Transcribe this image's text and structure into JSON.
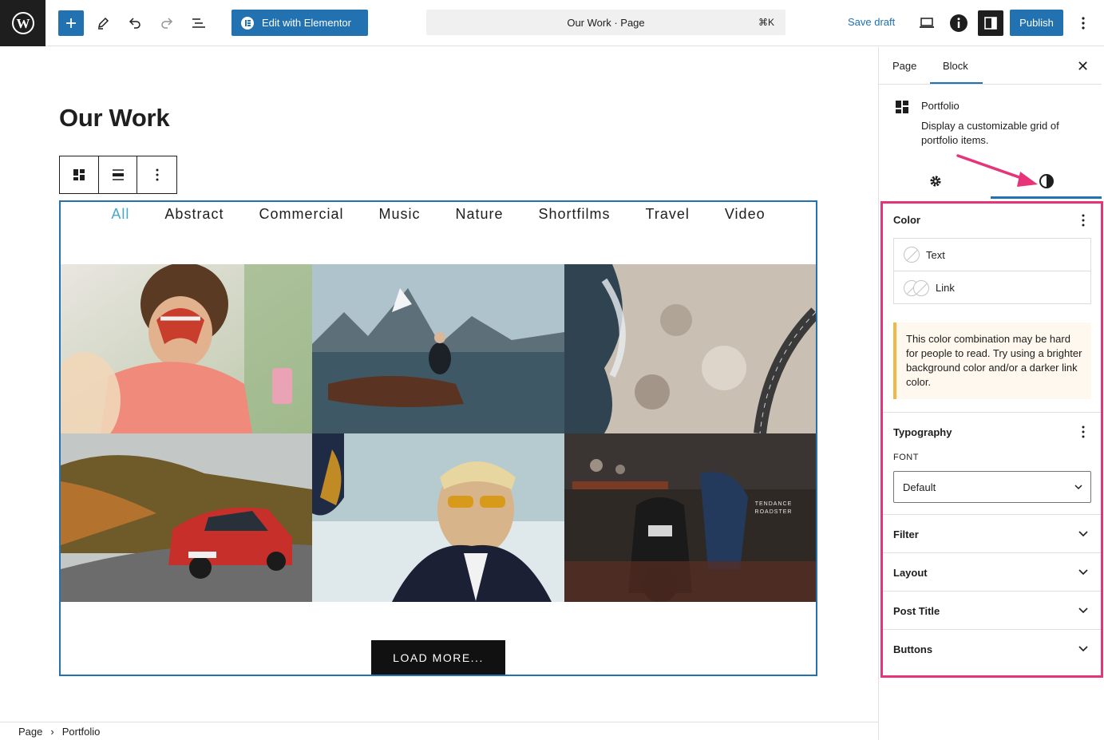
{
  "topbar": {
    "edit_elementor_label": "Edit with Elementor",
    "command_title": "Our Work · Page",
    "command_shortcut": "⌘K",
    "save_draft_label": "Save draft",
    "publish_label": "Publish"
  },
  "canvas": {
    "page_title": "Our Work",
    "filters": [
      "All",
      "Abstract",
      "Commercial",
      "Music",
      "Nature",
      "Shortfilms",
      "Travel",
      "Video"
    ],
    "active_filter": "All",
    "tile_overlay_text": [
      "TENDANCE",
      "ROADSTER"
    ],
    "load_more_label": "LOAD MORE..."
  },
  "breadcrumb": {
    "items": [
      "Page",
      "Portfolio"
    ]
  },
  "sidebar": {
    "tabs": [
      "Page",
      "Block"
    ],
    "active_tab": "Block",
    "block_name": "Portfolio",
    "block_description": "Display a customizable grid of portfolio items.",
    "color": {
      "title": "Color",
      "items": [
        "Text",
        "Link"
      ],
      "warning": "This color combination may be hard for people to read. Try using a brighter background color and/or a darker link color."
    },
    "typography": {
      "title": "Typography",
      "font_label": "FONT",
      "font_value": "Default"
    },
    "panels": [
      "Filter",
      "Layout",
      "Post Title",
      "Buttons"
    ]
  },
  "colors": {
    "accent": "#2271b1",
    "highlight": "#e6337a",
    "active_filter": "#48a8c8",
    "warning_border": "#f0b849"
  }
}
